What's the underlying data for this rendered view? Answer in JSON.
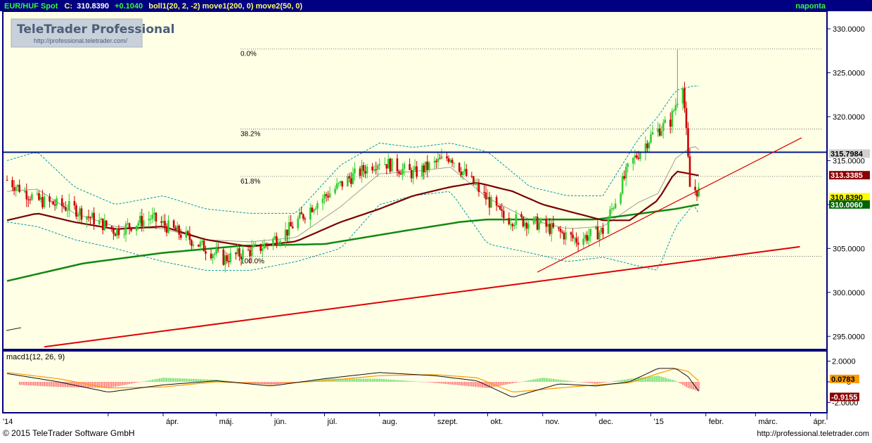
{
  "header": {
    "symbol": "EUR/HUF Spot",
    "close_label": "C:",
    "close_value": "310.8390",
    "change": "+0.1040",
    "indicators": "boll1(20, 2, -2) move1(200, 0) move2(50, 0)",
    "interval": "naponta"
  },
  "logo": {
    "title": "TeleTrader Professional",
    "url": "http://professional.teletrader.com/"
  },
  "footer": {
    "copyright": "© 2015 TeleTrader Software GmbH",
    "url": "http://professional.teletrader.com"
  },
  "colors": {
    "background": "#FFFFE6",
    "frame": "#000080",
    "price_up": "#33CC33",
    "price_down": "#CC0000",
    "bollinger": "#0099AA",
    "ma200": "#118811",
    "ma50": "#7A0000",
    "trendline": "#DD0000",
    "resistance": "#001A88",
    "macd_line": "#111111",
    "signal_line": "#FF9900",
    "histogram_pos": "#77E077",
    "histogram_neg": "#FF8080"
  },
  "chart_data": [
    {
      "type": "candlestick",
      "title": "EUR/HUF Spot",
      "x_tick_labels": [
        "'14",
        "ápr.",
        "máj.",
        "jún.",
        "júl.",
        "aug.",
        "szept.",
        "okt.",
        "nov.",
        "dec.",
        "'15",
        "febr.",
        "márc.",
        "ápr."
      ],
      "y_tick_labels": [
        "330.0000",
        "325.0000",
        "320.0000",
        "315.0000",
        "310.0000",
        "305.0000",
        "300.0000",
        "295.0000"
      ],
      "ylim": [
        293.5,
        332
      ],
      "price_tags": [
        {
          "value": 315.7984,
          "text": "315.7984",
          "color": "#000000",
          "bg": "#D0D0D0"
        },
        {
          "value": 313.3385,
          "text": "313.3385",
          "color": "#FFFFFF",
          "bg": "#8B0000"
        },
        {
          "value": 310.839,
          "text": "310.8390",
          "color": "#000000",
          "bg": "#FFFF00"
        },
        {
          "value": 310.006,
          "text": "310.0060",
          "color": "#FFFFFF",
          "bg": "#006400"
        }
      ],
      "fibonacci": [
        {
          "label": "0.0%",
          "value": 327.7
        },
        {
          "label": "38.2%",
          "value": 318.6
        },
        {
          "label": "61.8%",
          "value": 313.2
        },
        {
          "label": "100.0%",
          "value": 304.1
        }
      ],
      "horizontal_lines": [
        {
          "value": 315.95
        }
      ],
      "trendlines": [
        {
          "x": [
            "2014-01-24",
            "2015-03-26"
          ],
          "y": [
            293.8,
            305.2
          ]
        },
        {
          "x": [
            "2014-10-29",
            "2015-03-27"
          ],
          "y": [
            302.3,
            317.6
          ]
        }
      ],
      "price_path": {
        "x": [
          "2014-01-03",
          "2014-01-20",
          "2014-02-10",
          "2014-03-05",
          "2014-03-25",
          "2014-04-15",
          "2014-05-05",
          "2014-05-25",
          "2014-06-10",
          "2014-06-25",
          "2014-07-15",
          "2014-08-01",
          "2014-08-20",
          "2014-09-10",
          "2014-09-20",
          "2014-10-10",
          "2014-10-30",
          "2014-11-20",
          "2014-12-05",
          "2014-12-20",
          "2015-01-02",
          "2015-01-12",
          "2015-01-19",
          "2015-01-23",
          "2015-01-28"
        ],
        "y": [
          312.8,
          310.5,
          309.5,
          307.0,
          308.5,
          306.2,
          303.8,
          305.0,
          307.0,
          310.0,
          313.0,
          315.0,
          313.5,
          315.5,
          313.0,
          308.5,
          307.8,
          306.0,
          307.0,
          314.5,
          318.0,
          319.5,
          324.0,
          312.0,
          311.5
        ]
      },
      "bollinger_upper": {
        "x": [
          "2014-01-03",
          "2014-01-20",
          "2014-02-10",
          "2014-03-05",
          "2014-04-01",
          "2014-04-25",
          "2014-05-20",
          "2014-06-15",
          "2014-07-10",
          "2014-08-01",
          "2014-08-20",
          "2014-09-10",
          "2014-10-01",
          "2014-10-25",
          "2014-11-15",
          "2014-12-05",
          "2014-12-25",
          "2015-01-05",
          "2015-01-15",
          "2015-01-25",
          "2015-01-28"
        ],
        "y": [
          315.0,
          316.0,
          312.0,
          310.0,
          311.0,
          309.5,
          309.0,
          309.0,
          314.5,
          317.0,
          316.5,
          317.0,
          316.0,
          312.0,
          311.0,
          311.0,
          317.5,
          320.0,
          323.0,
          323.5,
          323.5
        ]
      },
      "bollinger_lower": {
        "x": [
          "2014-01-03",
          "2014-01-20",
          "2014-02-10",
          "2014-03-05",
          "2014-04-01",
          "2014-04-25",
          "2014-05-20",
          "2014-06-15",
          "2014-07-10",
          "2014-08-01",
          "2014-08-20",
          "2014-09-10",
          "2014-10-01",
          "2014-10-25",
          "2014-11-15",
          "2014-12-05",
          "2014-12-25",
          "2015-01-05",
          "2015-01-15",
          "2015-01-25",
          "2015-01-28"
        ],
        "y": [
          308.0,
          307.5,
          306.0,
          305.0,
          303.5,
          302.5,
          302.5,
          303.5,
          305.0,
          310.0,
          311.0,
          311.5,
          305.5,
          304.5,
          303.5,
          304.0,
          303.0,
          302.5,
          307.5,
          310.0,
          309.0
        ]
      },
      "ma50": {
        "name": "move2(50, 0)",
        "x": [
          "2014-01-03",
          "2014-01-20",
          "2014-02-10",
          "2014-03-05",
          "2014-04-01",
          "2014-04-25",
          "2014-05-20",
          "2014-06-15",
          "2014-07-10",
          "2014-08-01",
          "2014-08-20",
          "2014-09-10",
          "2014-09-25",
          "2014-10-15",
          "2014-11-01",
          "2014-11-20",
          "2014-12-05",
          "2014-12-20",
          "2015-01-05",
          "2015-01-15",
          "2015-01-28"
        ],
        "y": [
          308.2,
          309.0,
          308.0,
          307.2,
          307.5,
          306.0,
          305.2,
          305.8,
          308.0,
          309.5,
          311.0,
          312.0,
          312.5,
          311.5,
          310.0,
          309.0,
          308.2,
          308.2,
          310.5,
          313.8,
          313.3
        ]
      },
      "ma200": {
        "name": "move1(200, 0)",
        "x": [
          "2014-01-03",
          "2014-02-15",
          "2014-04-01",
          "2014-05-15",
          "2014-07-01",
          "2014-08-15",
          "2014-09-15",
          "2014-10-01",
          "2014-11-01",
          "2014-12-01",
          "2014-12-20",
          "2015-01-15",
          "2015-01-28"
        ],
        "y": [
          301.3,
          303.3,
          304.5,
          305.3,
          305.5,
          307.0,
          308.0,
          308.3,
          308.3,
          308.3,
          308.8,
          309.5,
          310.0
        ]
      }
    },
    {
      "type": "line",
      "title": "macd1(12, 26, 9)",
      "y_tick_labels": [
        "2.0000",
        "0",
        "-2.0000"
      ],
      "ylim": [
        -3.0,
        3.0
      ],
      "value_tags": [
        {
          "value": 0.0783,
          "text": "0.0783",
          "color": "#000000",
          "bg": "#FF9900"
        },
        {
          "value": -0.9155,
          "text": "-0.9155",
          "color": "#FFFFFF",
          "bg": "#8B0000"
        }
      ],
      "series": [
        {
          "name": "macd",
          "x": [
            "2014-01-03",
            "2014-02-01",
            "2014-03-01",
            "2014-04-01",
            "2014-05-01",
            "2014-06-01",
            "2014-07-01",
            "2014-08-01",
            "2014-09-01",
            "2014-09-25",
            "2014-10-15",
            "2014-11-10",
            "2014-12-01",
            "2014-12-20",
            "2015-01-05",
            "2015-01-15",
            "2015-01-22",
            "2015-01-28"
          ],
          "y": [
            0.8,
            0.0,
            -1.0,
            -0.3,
            0.1,
            -0.4,
            0.3,
            0.9,
            0.6,
            0.1,
            -1.5,
            -0.2,
            -0.4,
            0.0,
            1.3,
            1.3,
            0.5,
            -0.9
          ]
        },
        {
          "name": "signal",
          "x": [
            "2014-01-03",
            "2014-02-01",
            "2014-03-01",
            "2014-04-01",
            "2014-05-01",
            "2014-06-01",
            "2014-07-01",
            "2014-08-01",
            "2014-09-01",
            "2014-09-25",
            "2014-10-15",
            "2014-11-10",
            "2014-12-01",
            "2014-12-20",
            "2015-01-05",
            "2015-01-15",
            "2015-01-22",
            "2015-01-28"
          ],
          "y": [
            0.9,
            0.3,
            -0.6,
            -0.5,
            0.0,
            -0.2,
            0.1,
            0.6,
            0.7,
            0.4,
            -1.0,
            -0.6,
            -0.3,
            -0.1,
            0.8,
            1.3,
            1.0,
            0.08
          ]
        }
      ],
      "histogram": {
        "x": [
          "2014-01-10",
          "2014-02-01",
          "2014-03-01",
          "2014-04-01",
          "2014-05-01",
          "2014-06-01",
          "2014-07-01",
          "2014-08-01",
          "2014-09-01",
          "2014-10-01",
          "2014-11-01",
          "2014-12-01",
          "2014-12-20",
          "2015-01-05",
          "2015-01-15",
          "2015-01-22",
          "2015-01-28"
        ],
        "y": [
          -0.3,
          -0.5,
          -0.6,
          0.4,
          0.2,
          -0.3,
          0.3,
          0.3,
          -0.1,
          -0.6,
          0.4,
          -0.2,
          0.3,
          0.6,
          0.1,
          -0.6,
          -0.9
        ]
      }
    }
  ]
}
